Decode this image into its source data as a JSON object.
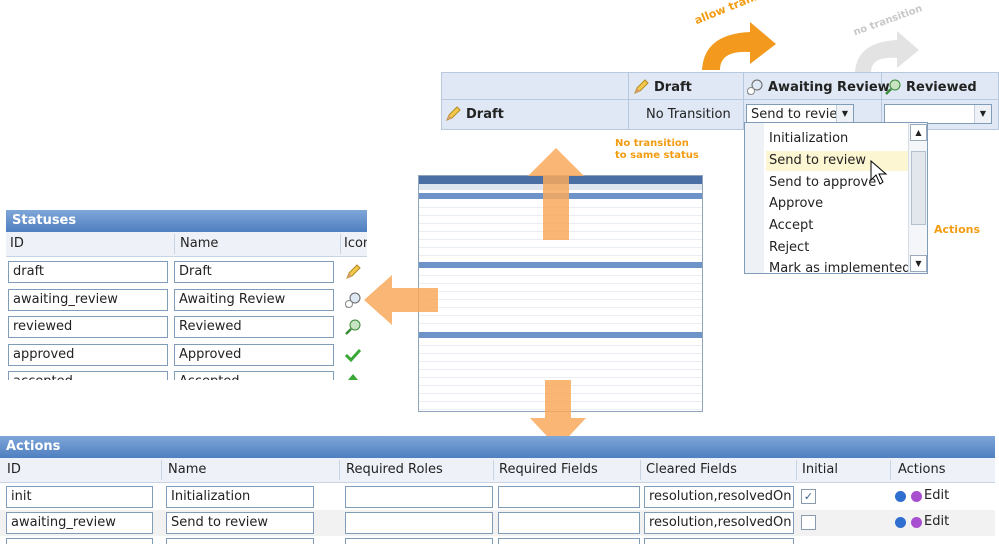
{
  "transitions": {
    "headers": [
      "Draft",
      "Awaiting Review",
      "Reviewed"
    ],
    "row_label": "Draft",
    "no_transition_text": "No Transition",
    "select_value": "Send to revie"
  },
  "dropdown": {
    "options": [
      "Initialization",
      "Send to review",
      "Send to approve",
      "Approve",
      "Accept",
      "Reject",
      "Mark as implemented"
    ],
    "selected_index": 1
  },
  "annotations": {
    "allow_transition": "allow transition",
    "no_transition": "no transition",
    "same_status_line1": "No transition",
    "same_status_line2": "to same status",
    "actions_label": "Actions"
  },
  "statuses": {
    "title": "Statuses",
    "columns": [
      "ID",
      "Name",
      "Icon"
    ],
    "rows": [
      {
        "id": "draft",
        "name": "Draft",
        "icon": "pencil-icon"
      },
      {
        "id": "awaiting_review",
        "name": "Awaiting Review",
        "icon": "magnifier-clock-icon"
      },
      {
        "id": "reviewed",
        "name": "Reviewed",
        "icon": "magnifier-check-icon"
      },
      {
        "id": "approved",
        "name": "Approved",
        "icon": "checkmark-icon"
      },
      {
        "id": "accepted",
        "name": "Accepted",
        "icon": "green-arrow-icon"
      }
    ]
  },
  "actions": {
    "title": "Actions",
    "columns": [
      "ID",
      "Name",
      "Required Roles",
      "Required Fields",
      "Cleared Fields",
      "Initial",
      "Actions"
    ],
    "rows": [
      {
        "id": "init",
        "name": "Initialization",
        "roles": "",
        "fields": "",
        "cleared": "resolution,resolvedOn",
        "initial": true,
        "edit": "Edit"
      },
      {
        "id": "awaiting_review",
        "name": "Send to review",
        "roles": "",
        "fields": "",
        "cleared": "resolution,resolvedOn",
        "initial": false,
        "edit": "Edit"
      }
    ]
  },
  "colors": {
    "accent": "#f5a623",
    "header_blue": "#4f7fc0",
    "check_green": "#3aa835"
  }
}
